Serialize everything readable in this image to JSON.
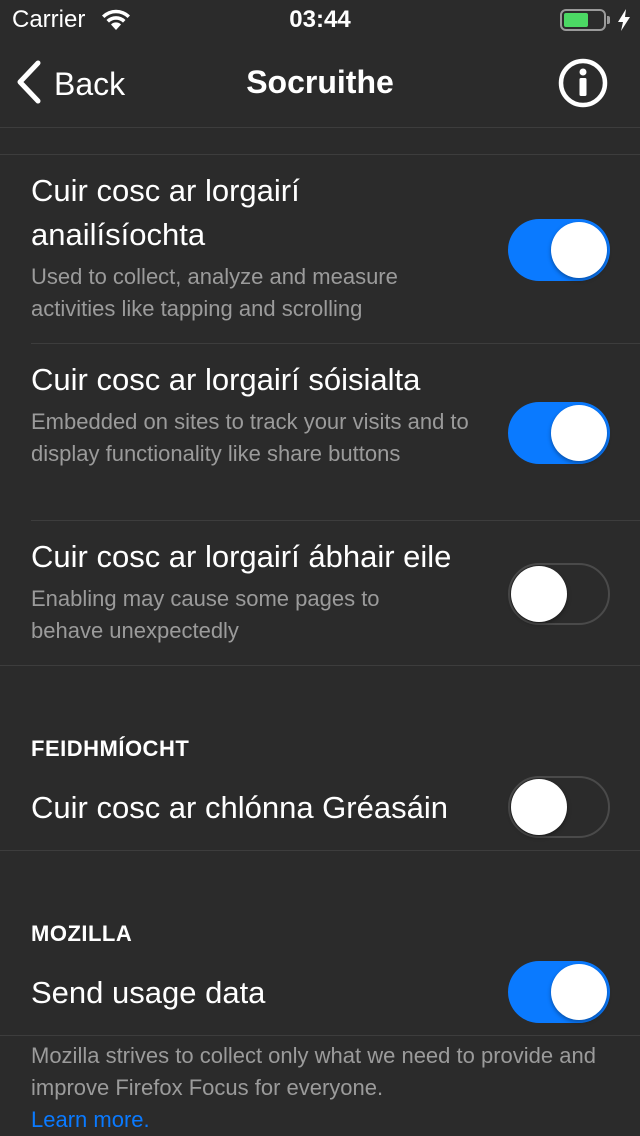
{
  "status_bar": {
    "carrier": "Carrier",
    "time": "03:44",
    "battery_color": "#4cd964"
  },
  "nav": {
    "back_label": "Back",
    "title": "Socruithe",
    "info_icon": "info-circle-icon"
  },
  "rows": [
    {
      "title_line1": "Cuir cosc ar lorgairí",
      "title_line2": "anailísíochta",
      "subtitle": "Used to collect, analyze and measure activities like tapping and scrolling",
      "enabled": true
    },
    {
      "title": "Cuir cosc ar lorgairí sóisialta",
      "subtitle": "Embedded on sites to track your visits and to display functionality like share buttons",
      "enabled": true
    },
    {
      "title": "Cuir cosc ar lorgairí ábhair eile",
      "subtitle": "Enabling may cause some pages to behave unexpectedly",
      "enabled": false
    }
  ],
  "performance": {
    "header": "FEIDHMÍOCHT",
    "title": "Cuir cosc ar chlónna Gréasáin",
    "enabled": false
  },
  "mozilla": {
    "header": "MOZILLA",
    "title": "Send usage data",
    "enabled": true,
    "footer": "Mozilla strives to collect only what we need to provide and improve Firefox Focus for everyone.",
    "learn_more": "Learn more."
  },
  "colors": {
    "accent": "#0a7aff",
    "background": "#2b2b2b",
    "secondary_text": "#9b9b9b"
  }
}
